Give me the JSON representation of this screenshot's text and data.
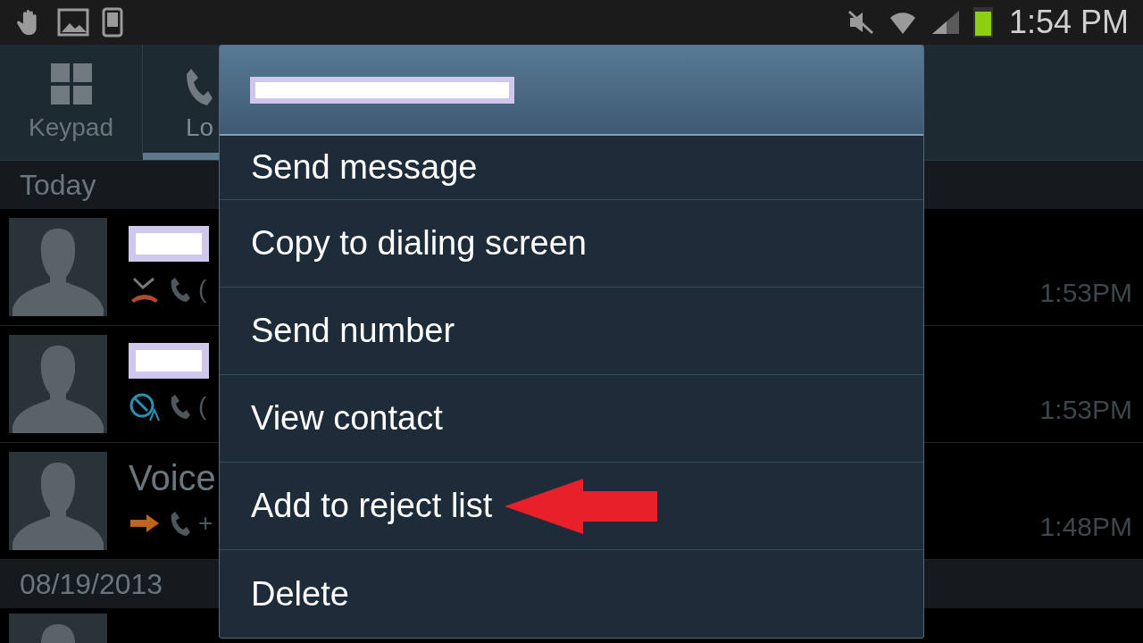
{
  "status_bar": {
    "time": "1:54 PM"
  },
  "tabs": [
    {
      "label": "Keypad",
      "kind": "keypad",
      "selected": false
    },
    {
      "label": "Lo",
      "kind": "phone",
      "selected": true
    }
  ],
  "sections": [
    {
      "header": "Today",
      "rows": [
        {
          "name_redacted": true,
          "kind": "rejected",
          "number": "(",
          "time": "1:53PM"
        },
        {
          "name_redacted": true,
          "kind": "auto_rejected",
          "number": "(",
          "time": "1:53PM"
        },
        {
          "name": "Voice",
          "kind": "forwarded",
          "number": "+",
          "time": "1:48PM"
        }
      ]
    },
    {
      "header": "08/19/2013",
      "rows": [
        {
          "partial": true
        }
      ]
    }
  ],
  "dialog": {
    "title_redacted": true,
    "items": [
      {
        "label": "Send message",
        "arrow": false
      },
      {
        "label": "Copy to dialing screen",
        "arrow": false
      },
      {
        "label": "Send number",
        "arrow": false
      },
      {
        "label": "View contact",
        "arrow": false
      },
      {
        "label": "Add to reject list",
        "arrow": true
      },
      {
        "label": "Delete",
        "arrow": false
      }
    ]
  }
}
